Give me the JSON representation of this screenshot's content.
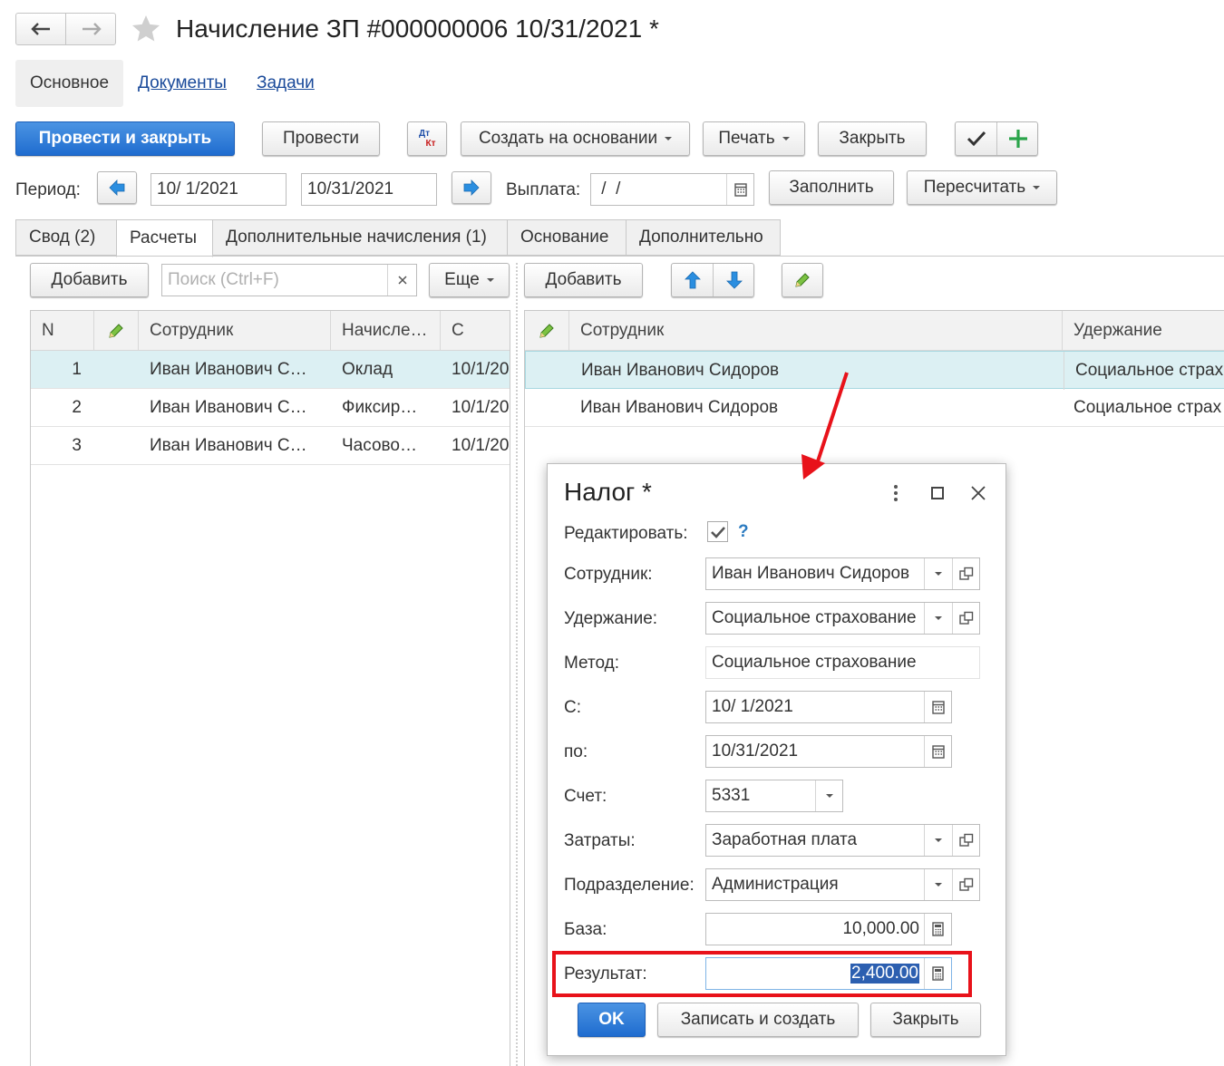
{
  "window": {
    "title": "Начисление ЗП #000000006 10/31/2021 *"
  },
  "nav_tabs": [
    "Основное",
    "Документы",
    "Задачи"
  ],
  "toolbar": {
    "post_close": "Провести и закрыть",
    "post": "Провести",
    "dtkt_top": "Дт",
    "dtkt_bottom": "Кт",
    "create_based": "Создать на основании",
    "print": "Печать",
    "close": "Закрыть"
  },
  "period": {
    "label": "Период:",
    "from": "10/ 1/2021",
    "to": "10/31/2021",
    "payment_label": "Выплата:",
    "payment_value": " /  /",
    "fill": "Заполнить",
    "recalc": "Пересчитать"
  },
  "tabs": [
    "Свод (2)",
    "Расчеты",
    "Дополнительные начисления (1)",
    "Основание",
    "Дополнительно"
  ],
  "left_panel": {
    "add": "Добавить",
    "search_placeholder": "Поиск (Ctrl+F)",
    "more": "Еще",
    "columns": [
      "N",
      "",
      "Сотрудник",
      "Начисле…",
      "С"
    ],
    "rows": [
      {
        "n": "1",
        "employee": "Иван Иванович С…",
        "accrual": "Оклад",
        "from": "10/1/20"
      },
      {
        "n": "2",
        "employee": "Иван Иванович С…",
        "accrual": "Фиксир…",
        "from": "10/1/20"
      },
      {
        "n": "3",
        "employee": "Иван Иванович С…",
        "accrual": "Часово…",
        "from": "10/1/20"
      }
    ]
  },
  "right_panel": {
    "add": "Добавить",
    "columns": [
      "",
      "Сотрудник",
      "Удержание"
    ],
    "rows": [
      {
        "employee": "Иван Иванович Сидоров",
        "deduction": "Социальное страх"
      },
      {
        "employee": "Иван Иванович Сидоров",
        "deduction": "Социальное страх"
      }
    ]
  },
  "dialog": {
    "title": "Налог *",
    "edit_label": "Редактировать:",
    "help": "?",
    "employee_label": "Сотрудник:",
    "employee": "Иван Иванович Сидоров",
    "deduction_label": "Удержание:",
    "deduction": "Социальное страхование",
    "method_label": "Метод:",
    "method": "Социальное страхование",
    "from_label": "С:",
    "from": "10/ 1/2021",
    "to_label": "по:",
    "to": "10/31/2021",
    "account_label": "Счет:",
    "account": "5331",
    "costs_label": "Затраты:",
    "costs": "Заработная плата",
    "division_label": "Подразделение:",
    "division": "Администрация",
    "base_label": "База:",
    "base": "10,000.00",
    "result_label": "Результат:",
    "result": "2,400.00",
    "ok": "OK",
    "save_create": "Записать и создать",
    "close": "Закрыть"
  },
  "colors": {
    "accent": "#2070d0",
    "selected_row": "#dcf0f3",
    "annotation_red": "#e8121a"
  }
}
